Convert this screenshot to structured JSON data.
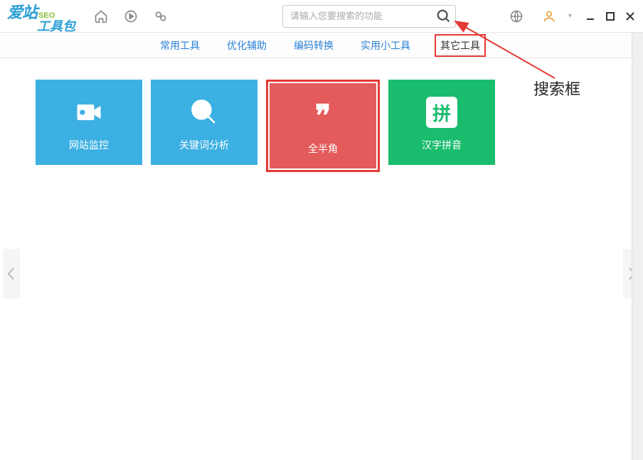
{
  "logo": {
    "main": "爱站",
    "seo": "SEO",
    "bag": "工具包"
  },
  "search": {
    "placeholder": "请输入您要搜索的功能"
  },
  "nav": {
    "items": [
      {
        "label": "常用工具"
      },
      {
        "label": "优化辅助"
      },
      {
        "label": "编码转换"
      },
      {
        "label": "实用小工具"
      },
      {
        "label": "其它工具"
      }
    ]
  },
  "tiles": [
    {
      "label": "网站监控",
      "color": "blue",
      "icon": "camera"
    },
    {
      "label": "关键词分析",
      "color": "blue2",
      "icon": "magnify-circle"
    },
    {
      "label": "全半角",
      "color": "red",
      "icon": "quote"
    },
    {
      "label": "汉字拼音",
      "color": "green",
      "icon": "pinyin",
      "glyph": "拼"
    }
  ],
  "annotation": {
    "label": "搜索框"
  }
}
